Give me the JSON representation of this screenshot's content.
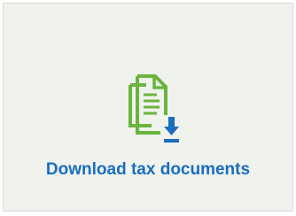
{
  "card": {
    "label": "Download tax documents",
    "icon": "document-download-icon"
  },
  "colors": {
    "card_background": "#eff2ed",
    "card_border": "#d6dbd3",
    "icon_green": "#6bb43e",
    "icon_blue": "#1a6dbf",
    "label_blue": "#1a6dbf"
  }
}
